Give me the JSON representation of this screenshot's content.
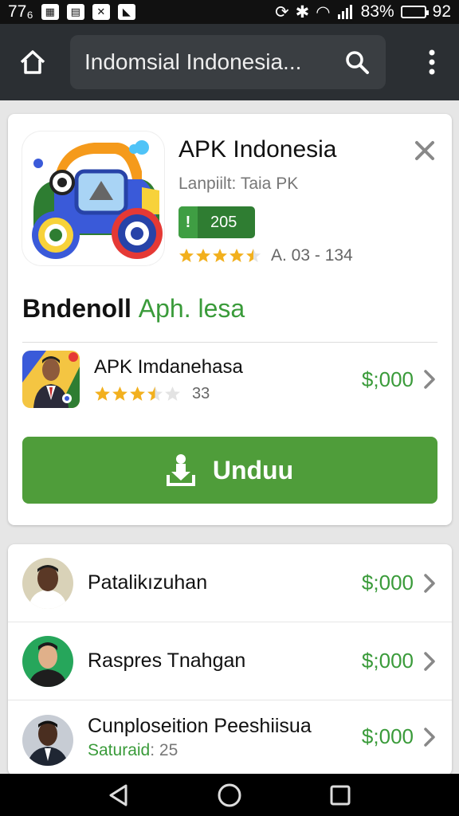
{
  "status_bar": {
    "left_text": "77₆",
    "battery_pct": "83%",
    "clock": "92"
  },
  "app_bar": {
    "search_value": "Indomsial Indonesia..."
  },
  "featured": {
    "title": "APK Indonesia",
    "subtitle": "Lanpiilt: Taia PK",
    "badge_count": "205",
    "rating_text": "A.  03 - 134",
    "rating": 4.5
  },
  "section": {
    "title": "Bndenoll",
    "accent": "Aph. lesa"
  },
  "featured_item": {
    "name": "APK Imdanehasa",
    "rating_count": "33",
    "rating": 3.5,
    "price": "$;000"
  },
  "download": {
    "label": "Unduu"
  },
  "list": [
    {
      "name": "Patalikızuhan",
      "price": "$;000"
    },
    {
      "name": "Raspres Tnahgan",
      "price": "$;000"
    },
    {
      "name": "Cunploseition Peeshiisua",
      "price": "$;000",
      "sub_label": "Saturaid",
      "sub_value": ": 25"
    }
  ],
  "colors": {
    "accent_green": "#3a9b3a",
    "button_green": "#4f9d3a",
    "badge_green": "#2f7d32",
    "star": "#f2b01e",
    "appbar": "#2b2f33"
  }
}
